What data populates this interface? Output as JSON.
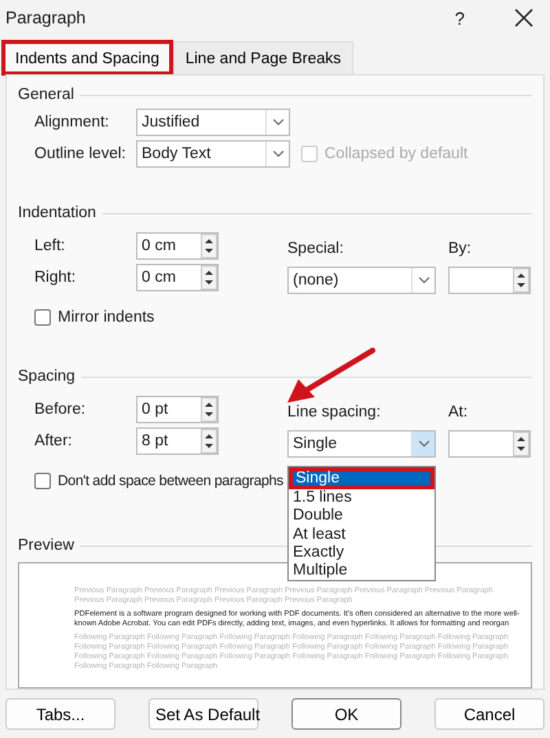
{
  "window": {
    "title": "Paragraph",
    "help": "?"
  },
  "tabs": [
    {
      "label": "Indents and Spacing",
      "selected": true,
      "highlighted": true
    },
    {
      "label": "Line and Page Breaks",
      "selected": false,
      "highlighted": false
    }
  ],
  "general": {
    "legend": "General",
    "alignment": {
      "label": "Alignment:",
      "value": "Justified"
    },
    "outline_level": {
      "label": "Outline level:",
      "value": "Body Text"
    },
    "collapsed": {
      "label": "Collapsed by default",
      "checked": false,
      "disabled": true
    }
  },
  "indentation": {
    "legend": "Indentation",
    "left": {
      "label": "Left:",
      "value": "0 cm"
    },
    "right": {
      "label": "Right:",
      "value": "0 cm"
    },
    "special": {
      "label": "Special:",
      "value": "(none)"
    },
    "by": {
      "label": "By:"
    },
    "mirror": {
      "label": "Mirror indents",
      "checked": false
    }
  },
  "spacing": {
    "legend": "Spacing",
    "before": {
      "label": "Before:",
      "value": "0 pt"
    },
    "after": {
      "label": "After:",
      "value": "8 pt"
    },
    "line_spacing": {
      "label": "Line spacing:",
      "value": "Single",
      "expanded": true,
      "options": [
        {
          "label": "Single",
          "selected": true,
          "highlighted": true
        },
        {
          "label": "1.5 lines",
          "selected": false,
          "highlighted": false
        },
        {
          "label": "Double",
          "selected": false,
          "highlighted": false
        },
        {
          "label": "At least",
          "selected": false,
          "highlighted": false
        },
        {
          "label": "Exactly",
          "selected": false,
          "highlighted": false
        },
        {
          "label": "Multiple",
          "selected": false,
          "highlighted": false
        }
      ]
    },
    "at": {
      "label": "At:"
    },
    "dont_add": {
      "label": "Don't add space between paragraphs",
      "checked": false
    }
  },
  "annotations": [
    {
      "kind": "arrow"
    }
  ],
  "preview": {
    "legend": "Preview",
    "previous": "Previous Paragraph Previous Paragraph Previous Paragraph Previous Paragraph Previous Paragraph Previous Paragraph Previous Paragraph Previous Paragraph Previous Paragraph Previous Paragraph",
    "body": "PDFelement is a software program designed for working with PDF documents. It's often considered an alternative to the more well-known Adobe Acrobat. You can edit PDFs directly, adding text, images, and even hyperlinks. It allows for formatting and reorgan",
    "following": "Following Paragraph Following Paragraph Following Paragraph Following Paragraph Following Paragraph Following Paragraph Following Paragraph Following Paragraph Following Paragraph Following Paragraph Following Paragraph Following Paragraph Following Paragraph Following Paragraph Following Paragraph Following Paragraph Following Paragraph Following Paragraph Following Paragraph Following Paragraph"
  },
  "buttons": [
    {
      "label": "Tabs...",
      "default": false
    },
    {
      "label": "Set As Default",
      "default": false
    },
    {
      "label": "OK",
      "default": true
    },
    {
      "label": "Cancel",
      "default": false
    }
  ]
}
